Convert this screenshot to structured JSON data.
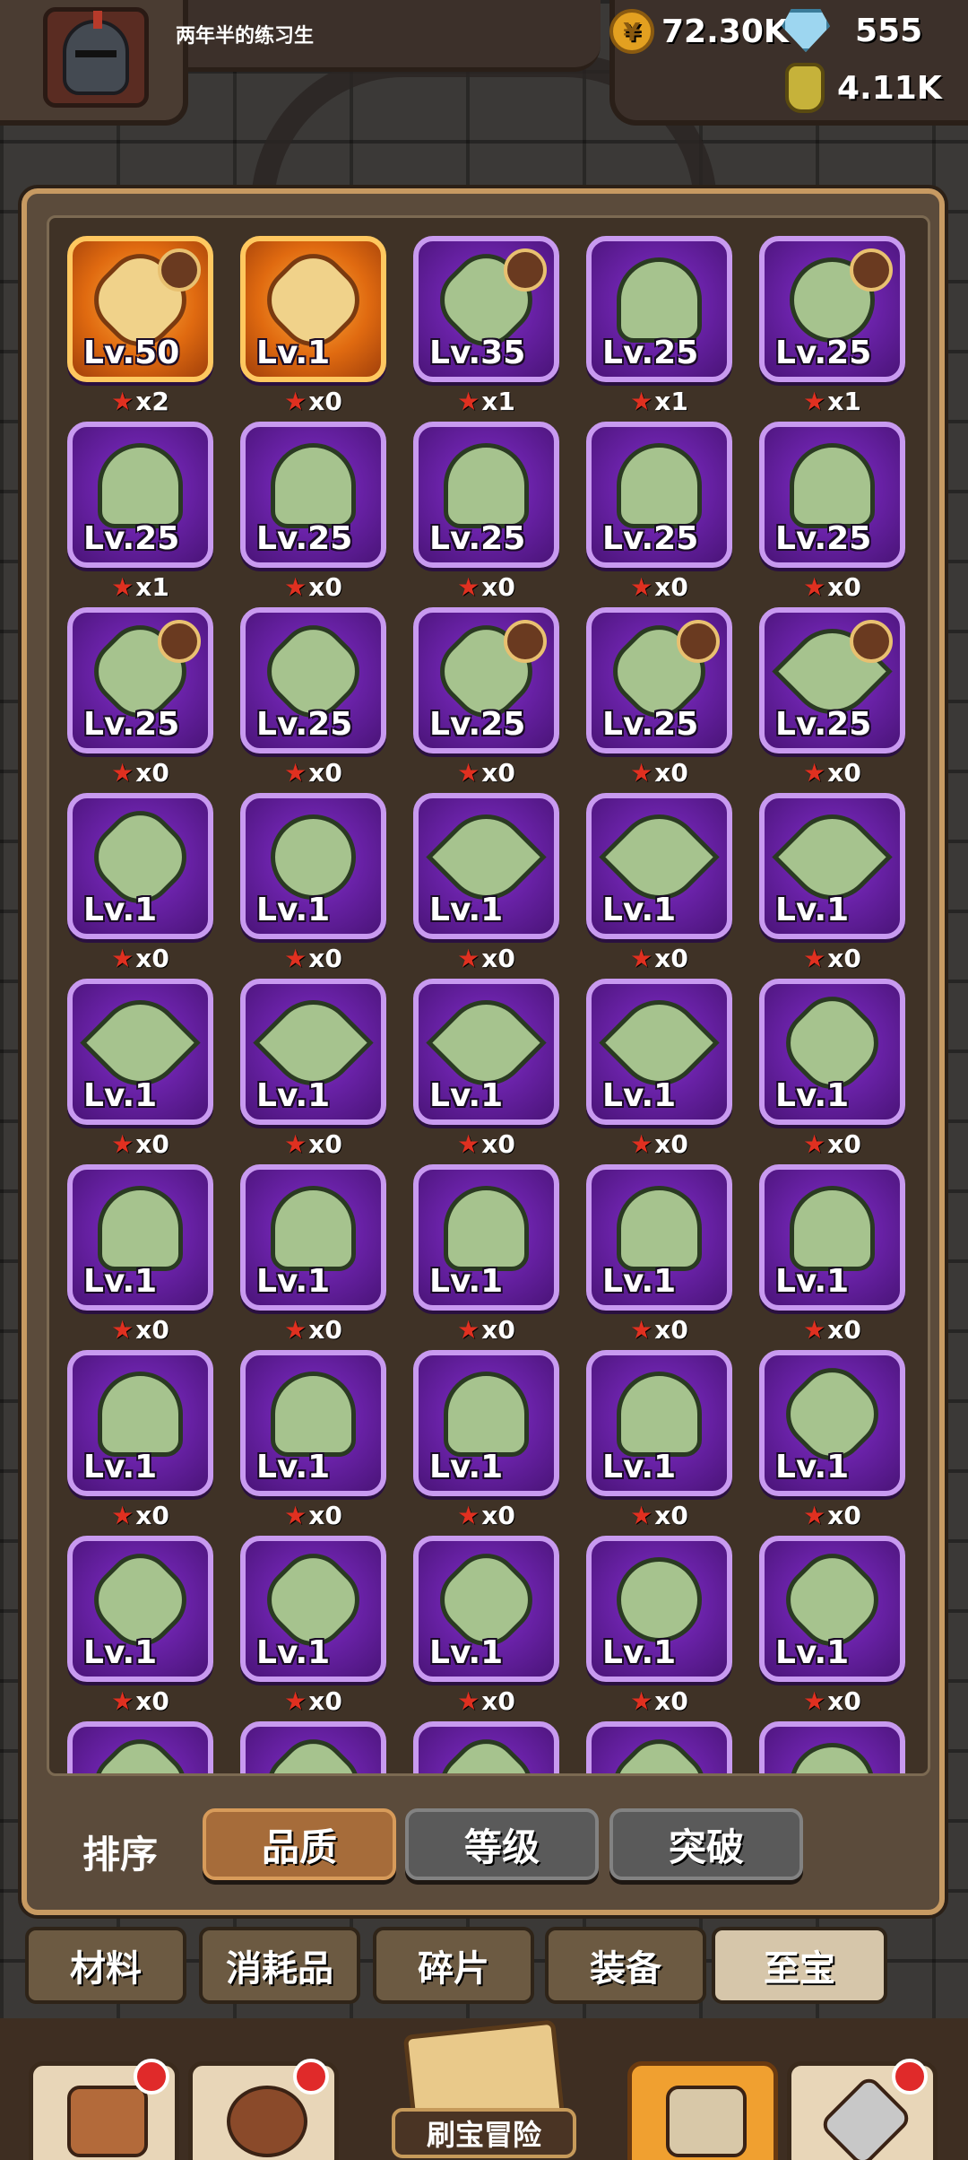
{
  "player": {
    "name": "两年半的练习生"
  },
  "resources": {
    "gold": "72.30K",
    "gems": "555",
    "potion": "4.11K"
  },
  "sort": {
    "label": "排序",
    "buttons": [
      "品质",
      "等级",
      "突破"
    ],
    "active_index": 0
  },
  "tabs": {
    "items": [
      "材料",
      "消耗品",
      "碎片",
      "装备",
      "至宝"
    ],
    "selected_index": 4
  },
  "nav": {
    "adventure_label": "刷宝冒险"
  },
  "colors": {
    "quality_purple": "#6a22a8",
    "quality_orange": "#e06a10",
    "star_red": "#e03020"
  },
  "treasures": [
    {
      "level": "Lv.50",
      "stars": "x2",
      "quality": "orange",
      "shape": "diamond",
      "badge": true
    },
    {
      "level": "Lv.1",
      "stars": "x0",
      "quality": "orange",
      "shape": "diamond",
      "badge": false
    },
    {
      "level": "Lv.35",
      "stars": "x1",
      "quality": "purple",
      "shape": "diamond",
      "badge": true
    },
    {
      "level": "Lv.25",
      "stars": "x1",
      "quality": "purple",
      "shape": "wing",
      "badge": false
    },
    {
      "level": "Lv.25",
      "stars": "x1",
      "quality": "purple",
      "shape": "round",
      "badge": true
    },
    {
      "level": "Lv.25",
      "stars": "x1",
      "quality": "purple",
      "shape": "wing",
      "badge": false
    },
    {
      "level": "Lv.25",
      "stars": "x0",
      "quality": "purple",
      "shape": "wing",
      "badge": false
    },
    {
      "level": "Lv.25",
      "stars": "x0",
      "quality": "purple",
      "shape": "wing",
      "badge": false
    },
    {
      "level": "Lv.25",
      "stars": "x0",
      "quality": "purple",
      "shape": "wing",
      "badge": false
    },
    {
      "level": "Lv.25",
      "stars": "x0",
      "quality": "purple",
      "shape": "wing",
      "badge": false
    },
    {
      "level": "Lv.25",
      "stars": "x0",
      "quality": "purple",
      "shape": "diamond",
      "badge": true
    },
    {
      "level": "Lv.25",
      "stars": "x0",
      "quality": "purple",
      "shape": "diamond",
      "badge": false
    },
    {
      "level": "Lv.25",
      "stars": "x0",
      "quality": "purple",
      "shape": "diamond",
      "badge": true
    },
    {
      "level": "Lv.25",
      "stars": "x0",
      "quality": "purple",
      "shape": "diamond",
      "badge": true
    },
    {
      "level": "Lv.25",
      "stars": "x0",
      "quality": "purple",
      "shape": "leaf",
      "badge": true
    },
    {
      "level": "Lv.1",
      "stars": "x0",
      "quality": "purple",
      "shape": "diamond",
      "badge": false
    },
    {
      "level": "Lv.1",
      "stars": "x0",
      "quality": "purple",
      "shape": "round",
      "badge": false
    },
    {
      "level": "Lv.1",
      "stars": "x0",
      "quality": "purple",
      "shape": "leaf",
      "badge": false
    },
    {
      "level": "Lv.1",
      "stars": "x0",
      "quality": "purple",
      "shape": "leaf",
      "badge": false
    },
    {
      "level": "Lv.1",
      "stars": "x0",
      "quality": "purple",
      "shape": "leaf",
      "badge": false
    },
    {
      "level": "Lv.1",
      "stars": "x0",
      "quality": "purple",
      "shape": "leaf",
      "badge": false
    },
    {
      "level": "Lv.1",
      "stars": "x0",
      "quality": "purple",
      "shape": "leaf",
      "badge": false
    },
    {
      "level": "Lv.1",
      "stars": "x0",
      "quality": "purple",
      "shape": "leaf",
      "badge": false
    },
    {
      "level": "Lv.1",
      "stars": "x0",
      "quality": "purple",
      "shape": "leaf",
      "badge": false
    },
    {
      "level": "Lv.1",
      "stars": "x0",
      "quality": "purple",
      "shape": "diamond",
      "badge": false
    },
    {
      "level": "Lv.1",
      "stars": "x0",
      "quality": "purple",
      "shape": "wing",
      "badge": false
    },
    {
      "level": "Lv.1",
      "stars": "x0",
      "quality": "purple",
      "shape": "wing",
      "badge": false
    },
    {
      "level": "Lv.1",
      "stars": "x0",
      "quality": "purple",
      "shape": "wing",
      "badge": false
    },
    {
      "level": "Lv.1",
      "stars": "x0",
      "quality": "purple",
      "shape": "wing",
      "badge": false
    },
    {
      "level": "Lv.1",
      "stars": "x0",
      "quality": "purple",
      "shape": "wing",
      "badge": false
    },
    {
      "level": "Lv.1",
      "stars": "x0",
      "quality": "purple",
      "shape": "wing",
      "badge": false
    },
    {
      "level": "Lv.1",
      "stars": "x0",
      "quality": "purple",
      "shape": "wing",
      "badge": false
    },
    {
      "level": "Lv.1",
      "stars": "x0",
      "quality": "purple",
      "shape": "wing",
      "badge": false
    },
    {
      "level": "Lv.1",
      "stars": "x0",
      "quality": "purple",
      "shape": "wing",
      "badge": false
    },
    {
      "level": "Lv.1",
      "stars": "x0",
      "quality": "purple",
      "shape": "diamond",
      "badge": false
    },
    {
      "level": "Lv.1",
      "stars": "x0",
      "quality": "purple",
      "shape": "diamond",
      "badge": false
    },
    {
      "level": "Lv.1",
      "stars": "x0",
      "quality": "purple",
      "shape": "diamond",
      "badge": false
    },
    {
      "level": "Lv.1",
      "stars": "x0",
      "quality": "purple",
      "shape": "diamond",
      "badge": false
    },
    {
      "level": "Lv.1",
      "stars": "x0",
      "quality": "purple",
      "shape": "round",
      "badge": false
    },
    {
      "level": "Lv.1",
      "stars": "x0",
      "quality": "purple",
      "shape": "diamond",
      "badge": false
    },
    {
      "level": "",
      "stars": "",
      "quality": "purple",
      "shape": "diamond",
      "badge": false
    },
    {
      "level": "",
      "stars": "",
      "quality": "purple",
      "shape": "diamond",
      "badge": false
    },
    {
      "level": "",
      "stars": "",
      "quality": "purple",
      "shape": "diamond",
      "badge": false
    },
    {
      "level": "",
      "stars": "",
      "quality": "purple",
      "shape": "diamond",
      "badge": false
    },
    {
      "level": "",
      "stars": "",
      "quality": "purple",
      "shape": "round",
      "badge": false
    }
  ]
}
